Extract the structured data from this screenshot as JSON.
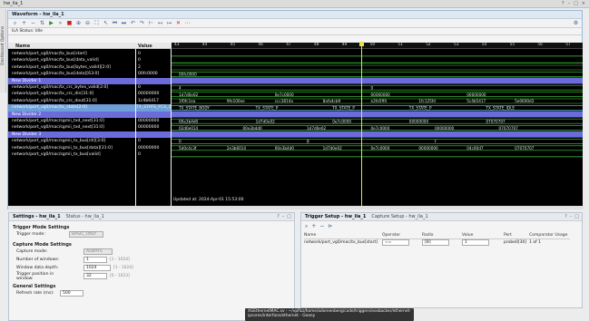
{
  "window": {
    "title": "hw_ila_1",
    "controls": [
      "?",
      "–",
      "□",
      "×"
    ]
  },
  "dashboard_strip": {
    "label": "Dashboard Options"
  },
  "waveform": {
    "title": "Waveform - hw_ila_1",
    "status": "ILA Status: Idle",
    "columns": {
      "name": "Name",
      "value": "Value"
    },
    "time_ticks": [
      "43",
      "44",
      "45",
      "46",
      "47",
      "48",
      "49",
      "50",
      "51",
      "52",
      "53",
      "54",
      "55",
      "56",
      "57"
    ],
    "cursor_marker": "48",
    "updated": "Updated at: 2024-Apr-01 15:53:00",
    "signals": [
      {
        "name": "network/port_vg0/mac/tx_bus[start]",
        "value": "0",
        "kind": "bit"
      },
      {
        "name": "network/port_vg0/mac/tx_bus[data_valid]",
        "value": "0",
        "kind": "bit"
      },
      {
        "name": "network/port_vg0/mac/tx_bus[bytes_valid][2:0]",
        "value": "2",
        "kind": "bus"
      },
      {
        "name": "network/port_vg0/mac/tx_bus[data][63:0]",
        "value": "00fc0000",
        "kind": "bus"
      },
      {
        "name": "New Divider 1",
        "value": "",
        "kind": "divider"
      },
      {
        "name": "network/port_vg0/mac/tx_crc_bytes_valid[2:0]",
        "value": "0",
        "kind": "bus"
      },
      {
        "name": "network/port_vg0/mac/tx_crc_din[31:0]",
        "value": "00000000",
        "kind": "bus"
      },
      {
        "name": "network/port_vg0/mac/tx_crc_dout[31:0]",
        "value": "1c4b6417",
        "kind": "bus"
      },
      {
        "name": "network/port_vg0/mac/tx_state[2:0]",
        "value": "TX_STATE_FCS_1",
        "kind": "selected"
      },
      {
        "name": "New Divider 2",
        "value": "",
        "kind": "divider"
      },
      {
        "name": "network/port_vg0/mac/sgmii_txd_next[31:0]",
        "value": "00000000",
        "kind": "bus"
      },
      {
        "name": "network/port_vg0/mac/sgmii_txd_next[31:0]",
        "value": "00000000",
        "kind": "bus"
      },
      {
        "name": "New Divider 3",
        "value": "",
        "kind": "divider"
      },
      {
        "name": "network/port_vg0/mac/sgmii_tx_bus[ctl][3:0]",
        "value": "0",
        "kind": "bus"
      },
      {
        "name": "network/port_vg0/mac/sgmii_tx_bus[data][31:0]",
        "value": "00000000",
        "kind": "bus"
      },
      {
        "name": "network/port_vg0/mac/sgmii_tx_bus[valid]",
        "value": "0",
        "kind": "bit"
      }
    ],
    "wave_labels": [
      {
        "row": 3,
        "items": [
          "00fc0000"
        ]
      },
      {
        "row": 5,
        "items": [
          "4",
          "0"
        ]
      },
      {
        "row": 6,
        "items": [
          "1d7d0e02",
          "0e7c0000",
          "00000000",
          "00000000"
        ]
      },
      {
        "row": 7,
        "items": [
          "1f0fc1ea",
          "9fe100ee",
          "ccc3814a",
          "8afa4cb9",
          "e2fe5ff4",
          "1fc125fd",
          "5c4b5417",
          "5e0600d3"
        ]
      },
      {
        "row": 8,
        "items": [
          "TX_STATE_BODY",
          "TX_STATE_P",
          "TX_STATE_P",
          "TX_STATE_P",
          "TX_STATE_IDLE"
        ]
      },
      {
        "row": 10,
        "items": [
          "00e3b4d0",
          "1d7d0e02",
          "0e7c0000",
          "00000000",
          "07070707"
        ]
      },
      {
        "row": 11,
        "items": [
          "02d0e014",
          "00e3b4d0",
          "1d7d0e02",
          "0e7c0000",
          "00000000",
          "07070707"
        ]
      },
      {
        "row": 13,
        "items": [
          "0",
          "8",
          "f"
        ]
      },
      {
        "row": 14,
        "items": [
          "5d0c4c3f",
          "2e3b6014",
          "00e3b4d0",
          "1d7d0e02",
          "0e7c0000",
          "00000000",
          "04c00d7",
          "07070707"
        ]
      }
    ]
  },
  "settings_pane": {
    "tabs": [
      "Settings - hw_ila_1",
      "Status - hw_ila_1"
    ],
    "trigger_mode_title": "Trigger Mode Settings",
    "trigger_mode_label": "Trigger mode:",
    "trigger_mode_value": "BASIC_ONLY",
    "capture_title": "Capture Mode Settings",
    "capture_mode_label": "Capture mode:",
    "capture_mode_value": "ALWAYS",
    "num_windows_label": "Number of windows:",
    "num_windows_value": "1",
    "num_windows_hint": "[1 - 1024]",
    "window_depth_label": "Window data depth:",
    "window_depth_value": "1024",
    "window_depth_hint": "[1 - 1024]",
    "trigger_pos_label": "Trigger position in window:",
    "trigger_pos_value": "32",
    "trigger_pos_hint": "[0 - 1023]",
    "general_title": "General Settings",
    "refresh_label": "Refresh rate (ms):",
    "refresh_value": "500"
  },
  "trigger_pane": {
    "tabs": [
      "Trigger Setup - hw_ila_1",
      "Capture Setup - hw_ila_1"
    ],
    "columns": [
      "Name",
      "Operator",
      "Radix",
      "Value",
      "Port",
      "Comparator Usage"
    ],
    "rows": [
      {
        "name": "network/port_vg0/mac/tx_bus[start]",
        "operator": "==",
        "radix": "[B]",
        "value": "1",
        "port": "probe0[30]",
        "usage": "1 of 1"
      }
    ]
  },
  "tooltip": {
    "line1": "XGEthernetMAC.sv - ~/vpfizz/home/adoreenberg/code/triggers/eosbacker/ethernet-",
    "line2": "ipcores/interface/ethernet - Geany"
  }
}
